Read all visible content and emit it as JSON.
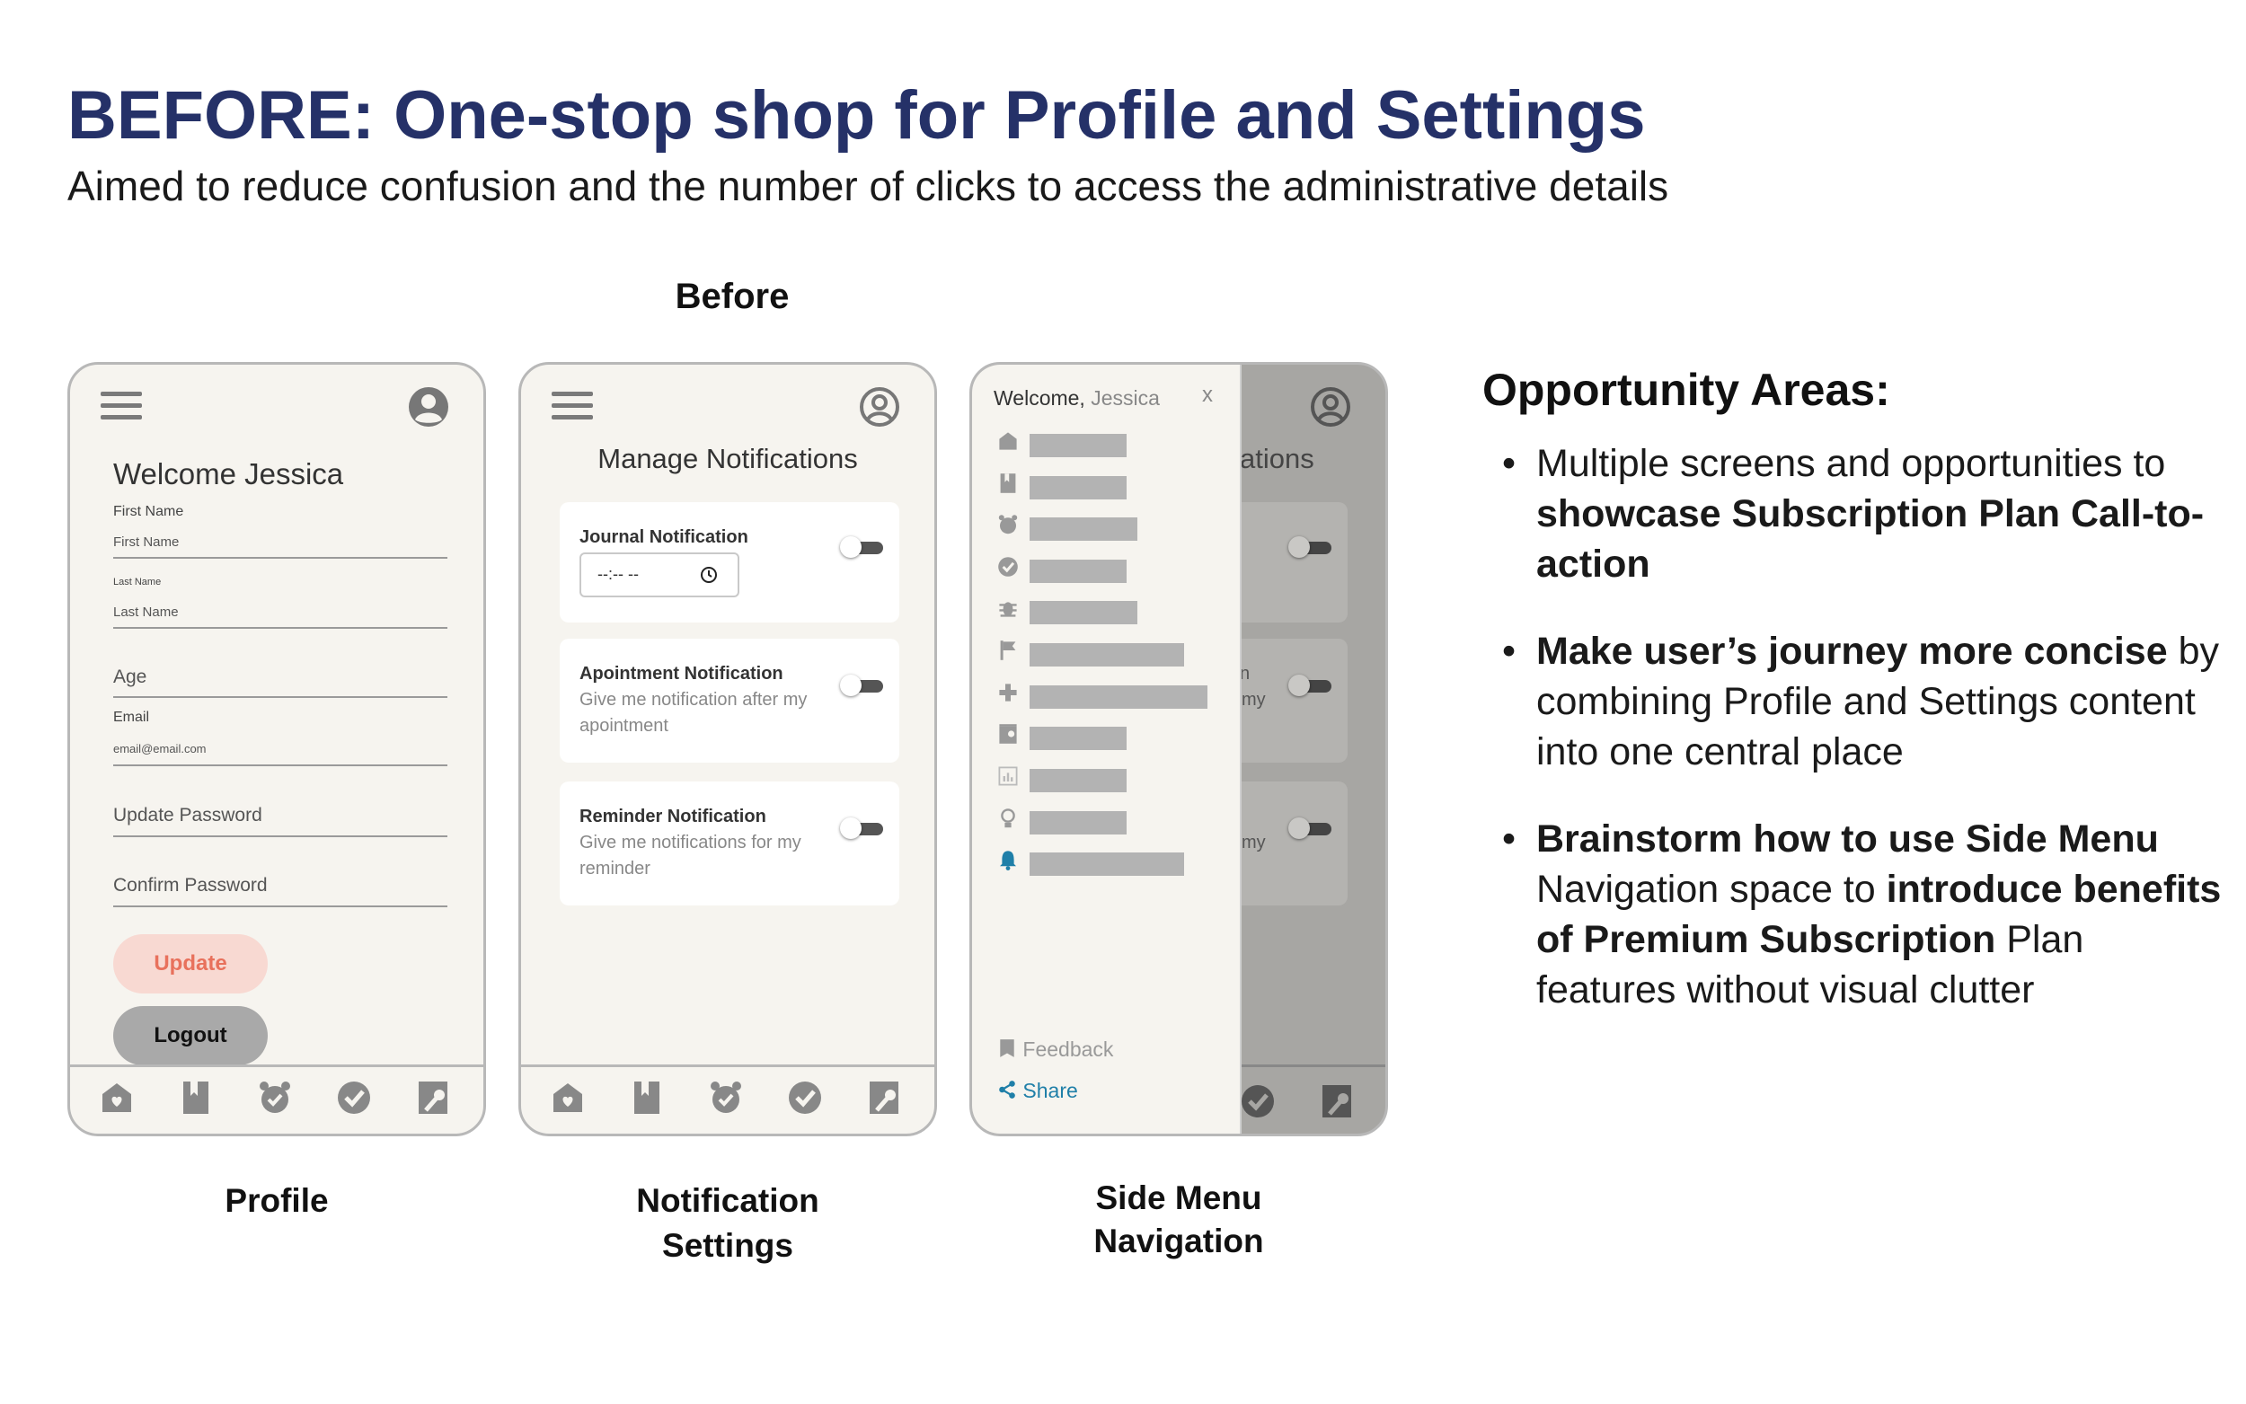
{
  "title": "BEFORE: One-stop shop for Profile and Settings",
  "subtitle": "Aimed to reduce confusion and the number of clicks to access the administrative details",
  "before_label": "Before",
  "profile": {
    "welcome": "Welcome Jessica",
    "first_name_label": "First Name",
    "first_name_placeholder": "First Name",
    "last_name_label": "Last Name",
    "last_name_placeholder": "Last Name",
    "age_placeholder": "Age",
    "email_label": "Email",
    "email_placeholder": "email@email.com",
    "update_password_placeholder": "Update Password",
    "confirm_password_placeholder": "Confirm Password",
    "update_button": "Update",
    "logout_button": "Logout",
    "caption": "Profile"
  },
  "notifications": {
    "title": "Manage Notifications",
    "cards": [
      {
        "title": "Journal Notification",
        "time": "--:-- --"
      },
      {
        "title": "Apointment Notification",
        "desc": "Give me notification after my apointment"
      },
      {
        "title": "Reminder Notification",
        "desc": "Give me notifications for my reminder"
      }
    ],
    "caption_line1": "Notification",
    "caption_line2": "Settings"
  },
  "side_menu": {
    "welcome_prefix": "Welcome,",
    "welcome_name": "Jessica",
    "close": "x",
    "behind_title_fragment": "ations",
    "behind_fragment_1": "n",
    "behind_fragment_2": "my",
    "behind_fragment_3": "my",
    "items": [
      {
        "icon": "home-heart-icon"
      },
      {
        "icon": "bookmark-icon"
      },
      {
        "icon": "alarm-clock-icon"
      },
      {
        "icon": "check-circle-icon"
      },
      {
        "icon": "bug-icon"
      },
      {
        "icon": "flag-icon"
      },
      {
        "icon": "plus-icon"
      },
      {
        "icon": "book-icon"
      },
      {
        "icon": "report-icon"
      },
      {
        "icon": "lightbulb-icon"
      },
      {
        "icon": "bell-icon"
      }
    ],
    "feedback": "Feedback",
    "share": "Share",
    "caption_line1": "Side Menu",
    "caption_line2": "Navigation"
  },
  "opportunity": {
    "title": "Opportunity Areas:",
    "b1_a": "Multiple screens and opportunities to ",
    "b1_b": "showcase Subscription Plan Call-to-action",
    "b2_a": "Make user’s journey more concise",
    "b2_b": " by combining Profile and Settings content into one central place",
    "b3_a": "Brainstorm how to use Side Menu",
    "b3_b": " Navigation space to ",
    "b3_c": "introduce benefits of Premium Subscription",
    "b3_d": " Plan features without visual clutter"
  },
  "colors": {
    "title": "#253168",
    "update_bg": "#f8d9d2",
    "update_text": "#e8715c",
    "logout_bg": "#a9a9a9",
    "accent_blue": "#1f7fa8"
  }
}
